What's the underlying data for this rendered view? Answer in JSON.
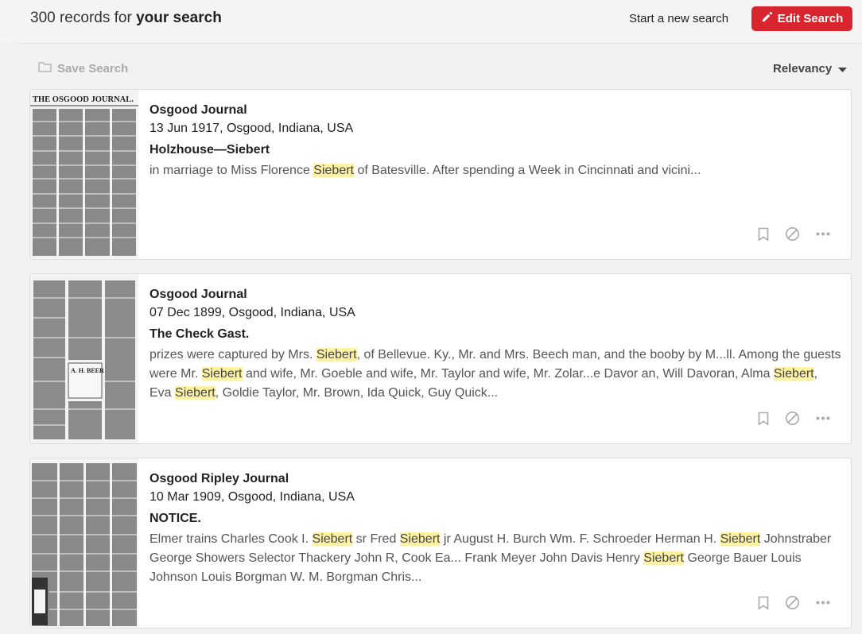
{
  "header": {
    "count_prefix": "300 records for ",
    "count_bold": "your search",
    "new_search_label": "Start a new search",
    "edit_search_label": "Edit Search"
  },
  "toolbar": {
    "save_search_label": "Save Search",
    "sort_label": "Relevancy"
  },
  "results": [
    {
      "publication": "Osgood Journal",
      "date_place": "13 Jun 1917, Osgood, Indiana, USA",
      "headline": "Holzhouse—Siebert",
      "snippet": [
        {
          "t": "in marriage to Miss Florence ",
          "h": false
        },
        {
          "t": "Siebert",
          "h": true
        },
        {
          "t": " of Batesville. After spending a Week in Cincinnati and vicini...",
          "h": false
        }
      ]
    },
    {
      "publication": "Osgood Journal",
      "date_place": "07 Dec 1899, Osgood, Indiana, USA",
      "headline": "The Check Gast.",
      "snippet": [
        {
          "t": "prizes were captured by Mrs. ",
          "h": false
        },
        {
          "t": "Siebert",
          "h": true
        },
        {
          "t": ", of Bellevue. Ky., Mr. and Mrs. Beech man, and the booby by M...ll. Among the guests were Mr. ",
          "h": false
        },
        {
          "t": "Siebert",
          "h": true
        },
        {
          "t": " and wife, Mr. Goeble and wife, Mr. Taylor and wife, Mr. Zolar...e Davor an, Will Davoran, Alma ",
          "h": false
        },
        {
          "t": "Siebert",
          "h": true
        },
        {
          "t": ", Eva ",
          "h": false
        },
        {
          "t": "Siebert",
          "h": true
        },
        {
          "t": ", Goldie Taylor, Mr. Brown, Ida Quick, Guy Quick...",
          "h": false
        }
      ]
    },
    {
      "publication": "Osgood Ripley Journal",
      "date_place": "10 Mar 1909, Osgood, Indiana, USA",
      "headline": "NOTICE.",
      "snippet": [
        {
          "t": "Elmer trains Charles Cook I. ",
          "h": false
        },
        {
          "t": "Siebert",
          "h": true
        },
        {
          "t": " sr Fred ",
          "h": false
        },
        {
          "t": "Siebert",
          "h": true
        },
        {
          "t": " jr August H. Burch Wm. F. Schroeder Herman H. ",
          "h": false
        },
        {
          "t": "Siebert",
          "h": true
        },
        {
          "t": " Johnstraber George Showers Selector Thackery John R, Cook Ea... Frank Meyer John Davis Henry ",
          "h": false
        },
        {
          "t": "Siebert",
          "h": true
        },
        {
          "t": " George Bauer Louis Johnson Louis Borgman W. M. Borgman Chris...",
          "h": false
        }
      ]
    }
  ],
  "thumb_masthead": "THE OSGOOD JOURNAL.",
  "thumb_ad_text": "A. H. BEER",
  "icons": {
    "edit": "pencil-icon",
    "save": "folder-icon",
    "sort": "caret-down-icon",
    "bookmark": "bookmark-icon",
    "hide": "block-icon",
    "more": "more-icon"
  },
  "colors": {
    "accent": "#d9262e",
    "highlight": "#fdf2a4"
  }
}
